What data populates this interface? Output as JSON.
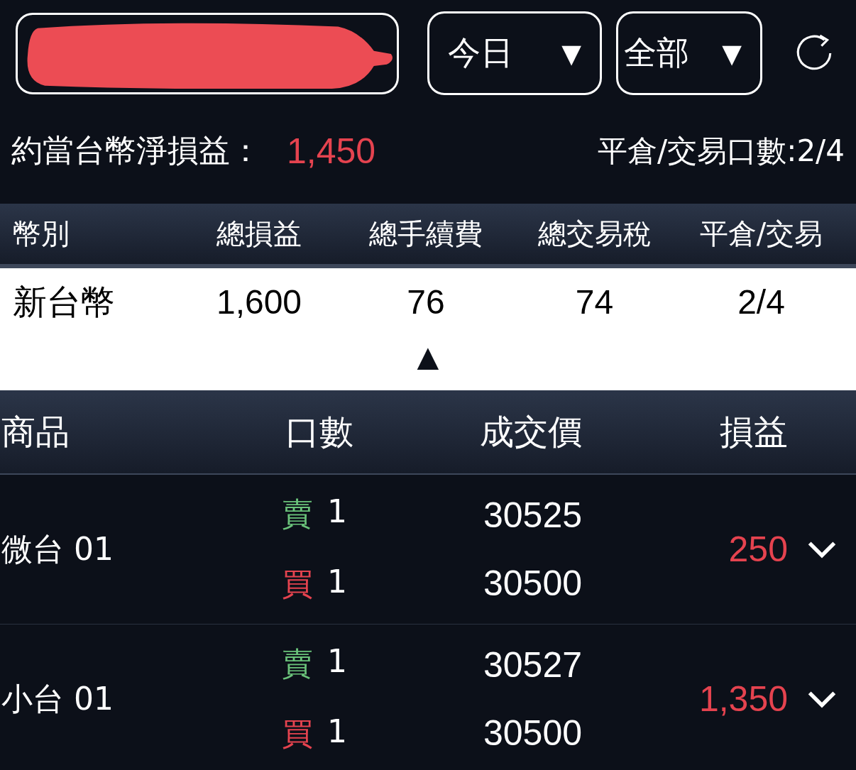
{
  "account_field": {
    "redacted": true
  },
  "filters": [
    {
      "label": "今日",
      "arrow": "▼"
    },
    {
      "label": "全部",
      "arrow": "▼"
    }
  ],
  "summary": {
    "label": "約當台幣淨損益：",
    "value": "1,450",
    "color": "#e5434f",
    "right": "平倉/交易口數:2/4"
  },
  "summary_table": {
    "columns": [
      "幣別",
      "總損益",
      "總手續費",
      "總交易稅",
      "平倉/交易"
    ],
    "rows": [
      [
        "新台幣",
        "1,600",
        "76",
        "74",
        "2/4"
      ]
    ],
    "collapse": "▲"
  },
  "trades_table": {
    "columns": [
      "商品",
      "口數",
      "成交價",
      "損益"
    ],
    "rows": [
      {
        "product": "微台 01",
        "legs": [
          {
            "side": "賣",
            "color": "#6ac27a",
            "qty": "1",
            "price": "30525"
          },
          {
            "side": "買",
            "color": "#e5434f",
            "qty": "1",
            "price": "30500"
          }
        ],
        "pnl": "250",
        "color": "#e5434f",
        "expanded": false
      },
      {
        "product": "小台 01",
        "legs": [
          {
            "side": "賣",
            "color": "#6ac27a",
            "qty": "1",
            "price": "30527"
          },
          {
            "side": "買",
            "color": "#e5434f",
            "qty": "1",
            "price": "30500"
          }
        ],
        "pnl": "1,350",
        "color": "#e5434f",
        "expanded": false
      }
    ]
  }
}
